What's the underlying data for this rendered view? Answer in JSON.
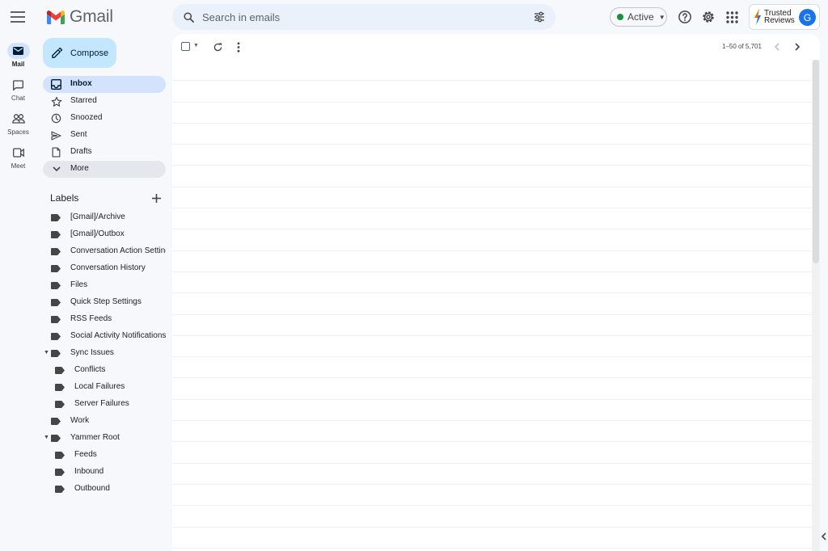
{
  "app": {
    "name": "Gmail",
    "colors": {
      "accent": "#1a73e8",
      "compose_bg": "#c2e7ff",
      "active_nav": "#d3e3fd",
      "status_green": "#1e8e3e"
    }
  },
  "search": {
    "placeholder": "Search in emails"
  },
  "status": {
    "label": "Active"
  },
  "account": {
    "avatar_letter": "G",
    "brand_line1": "Trusted",
    "brand_line2": "Reviews"
  },
  "rail": {
    "items": [
      {
        "label": "Mail",
        "icon": "mail-icon"
      },
      {
        "label": "Chat",
        "icon": "chat-icon"
      },
      {
        "label": "Spaces",
        "icon": "spaces-icon"
      },
      {
        "label": "Meet",
        "icon": "meet-icon"
      }
    ]
  },
  "sidebar": {
    "compose_label": "Compose",
    "nav": [
      {
        "label": "Inbox",
        "icon": "inbox-icon"
      },
      {
        "label": "Starred",
        "icon": "star-icon"
      },
      {
        "label": "Snoozed",
        "icon": "clock-icon"
      },
      {
        "label": "Sent",
        "icon": "send-icon"
      },
      {
        "label": "Drafts",
        "icon": "draft-icon"
      },
      {
        "label": "More",
        "icon": "chevron-down-icon"
      }
    ],
    "labels_heading": "Labels",
    "labels": [
      {
        "label": "[Gmail]/Archive"
      },
      {
        "label": "[Gmail]/Outbox"
      },
      {
        "label": "Conversation Action Settings"
      },
      {
        "label": "Conversation History"
      },
      {
        "label": "Files"
      },
      {
        "label": "Quick Step Settings"
      },
      {
        "label": "RSS Feeds"
      },
      {
        "label": "Social Activity Notifications"
      },
      {
        "label": "Sync Issues"
      },
      {
        "label": "Conflicts"
      },
      {
        "label": "Local Failures"
      },
      {
        "label": "Server Failures"
      },
      {
        "label": "Work"
      },
      {
        "label": "Yammer Root"
      },
      {
        "label": "Feeds"
      },
      {
        "label": "Inbound"
      },
      {
        "label": "Outbound"
      }
    ]
  },
  "toolbar": {
    "pagination": "1–50 of 5,701"
  }
}
